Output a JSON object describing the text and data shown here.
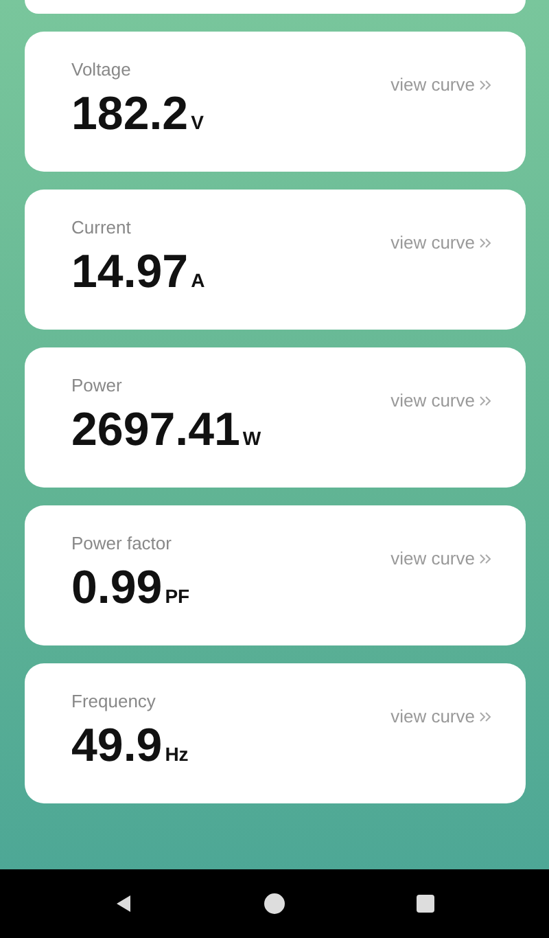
{
  "metrics": [
    {
      "label": "Voltage",
      "value": "182.2",
      "unit": "V",
      "link": "view curve"
    },
    {
      "label": "Current",
      "value": "14.97",
      "unit": "A",
      "link": "view curve"
    },
    {
      "label": "Power",
      "value": "2697.41",
      "unit": "W",
      "link": "view curve"
    },
    {
      "label": "Power factor",
      "value": "0.99",
      "unit": "PF",
      "link": "view curve"
    },
    {
      "label": "Frequency",
      "value": "49.9",
      "unit": "Hz",
      "link": "view curve"
    }
  ]
}
